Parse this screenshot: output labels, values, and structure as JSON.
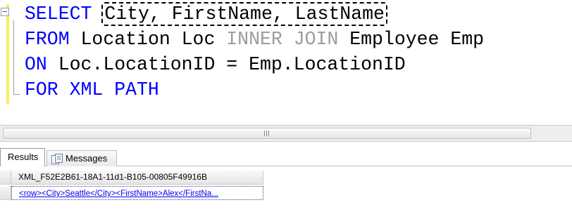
{
  "editor": {
    "lines": [
      {
        "keyword": "SELECT",
        "columns": "City, FirstName, LastName"
      },
      {
        "keyword": "FROM",
        "text1": "Location Loc",
        "join": "INNER JOIN",
        "text2": "Employee Emp"
      },
      {
        "keyword": "ON",
        "text1": "Loc.LocationID = Emp.LocationID"
      },
      {
        "keyword": "FOR XML PATH"
      }
    ],
    "colors": {
      "keyword": "#0000ff",
      "join": "#9c9c9c",
      "highlight": "#f6ef63"
    }
  },
  "splitter": {
    "grip": "|||"
  },
  "tabs": [
    {
      "label": "Results",
      "active": true
    },
    {
      "label": "Messages",
      "icon": "messages-icon"
    }
  ],
  "grid": {
    "column_header": "XML_F52E2B61-18A1-11d1-B105-00805F49916B",
    "rows": [
      {
        "value": "<row><City>Seattle</City><FirstName>Alex</FirstNa..."
      }
    ]
  }
}
